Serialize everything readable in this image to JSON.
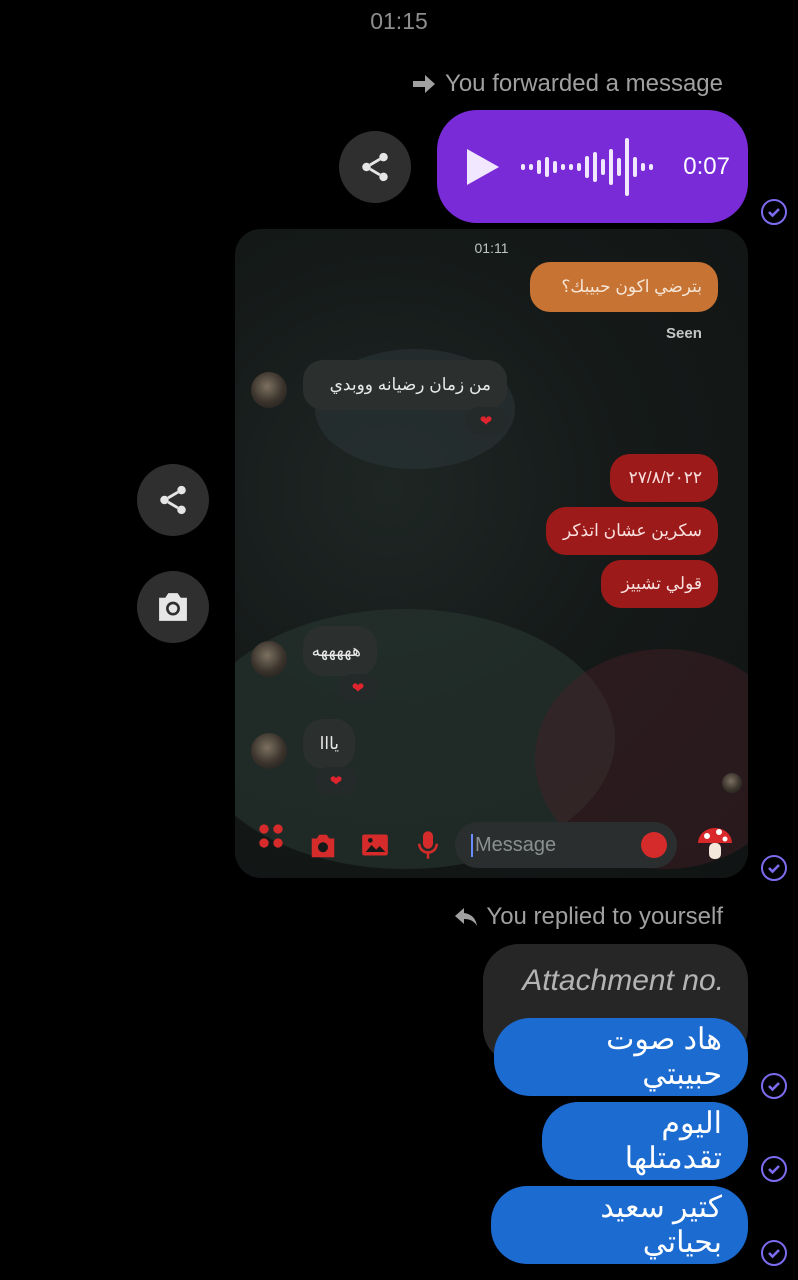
{
  "header": {
    "time": "01:15"
  },
  "forward": {
    "label": "You forwarded a message"
  },
  "voice": {
    "duration": "0:07"
  },
  "inner": {
    "time": "01:11",
    "messages": [
      {
        "text": "بترضي اكون حبيبك؟"
      },
      {
        "text": "من زمان رضيانه ووبدي"
      },
      {
        "text": "٢٧/٨/٢٠٢٢"
      },
      {
        "text": "سكرين عشان اتذكر"
      },
      {
        "text": "قولي تشييز"
      },
      {
        "text": "هههههه"
      },
      {
        "text": "يااا"
      }
    ],
    "seen": "Seen",
    "reaction": "❤",
    "input_placeholder": "Message"
  },
  "reply": {
    "label": "You replied to yourself"
  },
  "attachment": {
    "text": "Attachment no."
  },
  "bottom_messages": [
    {
      "text": "هاد صوت حبيبتي"
    },
    {
      "text": "اليوم تقدمتلها"
    },
    {
      "text": "كتير سعيد بحياتي"
    }
  ],
  "icons": [
    "share-icon",
    "camera-icon",
    "forward-arrow-icon",
    "reply-arrow-icon",
    "play-icon",
    "check-icon",
    "apps-icon",
    "image-icon",
    "mic-icon",
    "emoji-icon",
    "mushroom-icon"
  ],
  "colors": {
    "voice_bubble": "#7a2bd8",
    "blue_bubble": "#1b6bd1",
    "check": "#7c6cf0"
  }
}
